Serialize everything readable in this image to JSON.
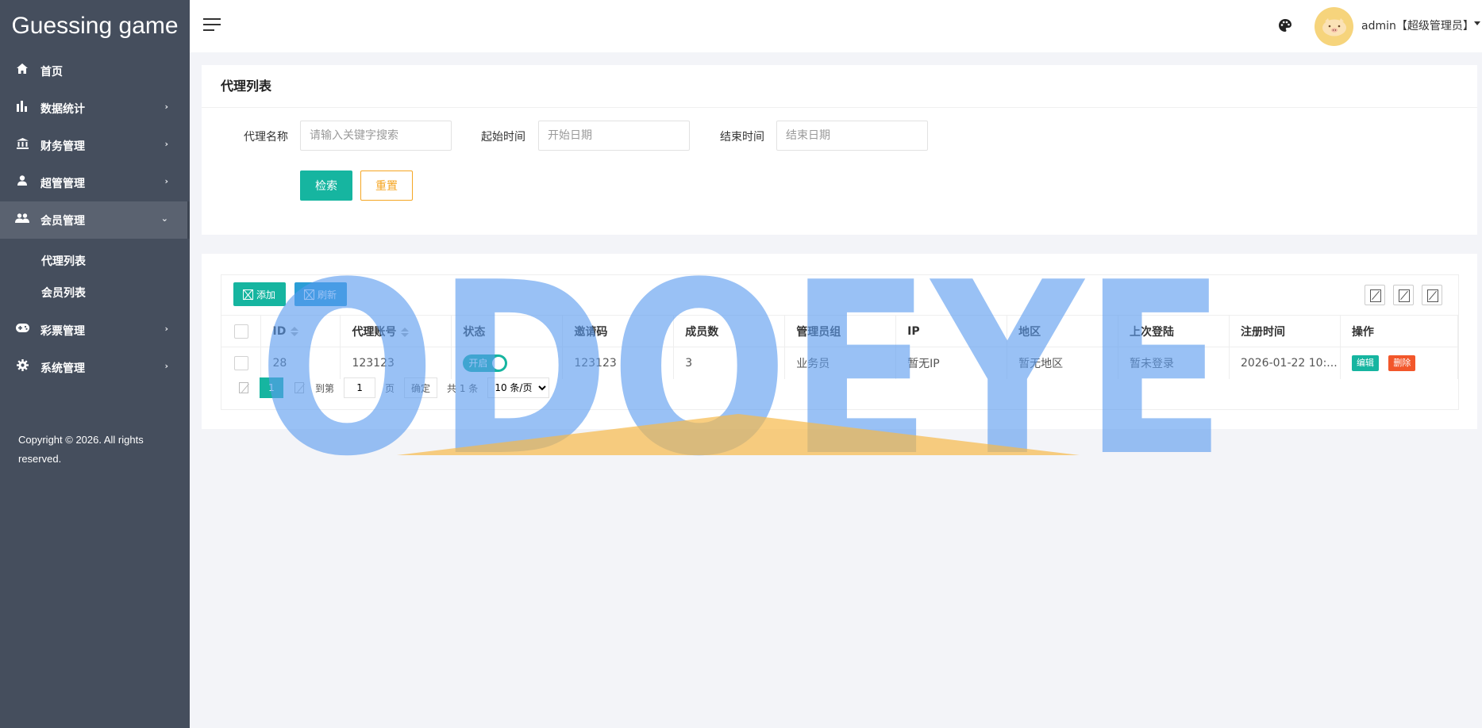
{
  "app": {
    "brand": "Guessing game"
  },
  "sidebar": {
    "items": [
      {
        "label": "首页",
        "icon": "home-icon",
        "has_children": false
      },
      {
        "label": "数据统计",
        "icon": "bar-chart-icon",
        "has_children": true
      },
      {
        "label": "财务管理",
        "icon": "bank-icon",
        "has_children": true
      },
      {
        "label": "超管管理",
        "icon": "user-icon",
        "has_children": true
      },
      {
        "label": "会员管理",
        "icon": "group-icon",
        "has_children": true,
        "expanded": true
      }
    ],
    "subitems": [
      {
        "label": "代理列表"
      },
      {
        "label": "会员列表"
      }
    ],
    "items_after": [
      {
        "label": "彩票管理",
        "icon": "gamepad-icon",
        "has_children": true
      },
      {
        "label": "系统管理",
        "icon": "gear-icon",
        "has_children": true
      }
    ],
    "copyright": "Copyright © 2026. All rights reserved."
  },
  "header": {
    "menu_icon": "hamburger-icon",
    "theme_icon": "palette-icon",
    "user_label": "admin【超级管理员】"
  },
  "search": {
    "title": "代理列表",
    "fields": [
      {
        "label": "代理名称",
        "placeholder": "请输入关键字搜索"
      },
      {
        "label": "起始时间",
        "placeholder": "开始日期"
      },
      {
        "label": "结束时间",
        "placeholder": "结束日期"
      }
    ],
    "search_button": "检索",
    "reset_button": "重置"
  },
  "table": {
    "toolbar": {
      "add": "添加",
      "refresh": "刷新"
    },
    "columns": [
      "ID",
      "代理账号",
      "状态",
      "邀请码",
      "成员数",
      "管理员组",
      "IP",
      "地区",
      "上次登陆",
      "注册时间",
      "操作"
    ],
    "rows": [
      {
        "id": "28",
        "account": "123123",
        "status": "开启",
        "invite_code": "123123",
        "members": "3",
        "group": "业务员",
        "ip": "暂无IP",
        "region": "暂无地区",
        "last_login": "暂未登录",
        "registered": "2026-01-22 10:...",
        "edit": "编辑",
        "delete": "删除"
      }
    ],
    "pager": {
      "current": "1",
      "goto_prefix": "到第",
      "goto_value": "1",
      "goto_suffix": "页",
      "confirm": "确定",
      "total": "共 1 条",
      "page_size": "10 条/页"
    }
  },
  "watermark": {
    "text": "ODOEYE",
    "color": "#5b9bef",
    "accent": "#f6b94a"
  }
}
